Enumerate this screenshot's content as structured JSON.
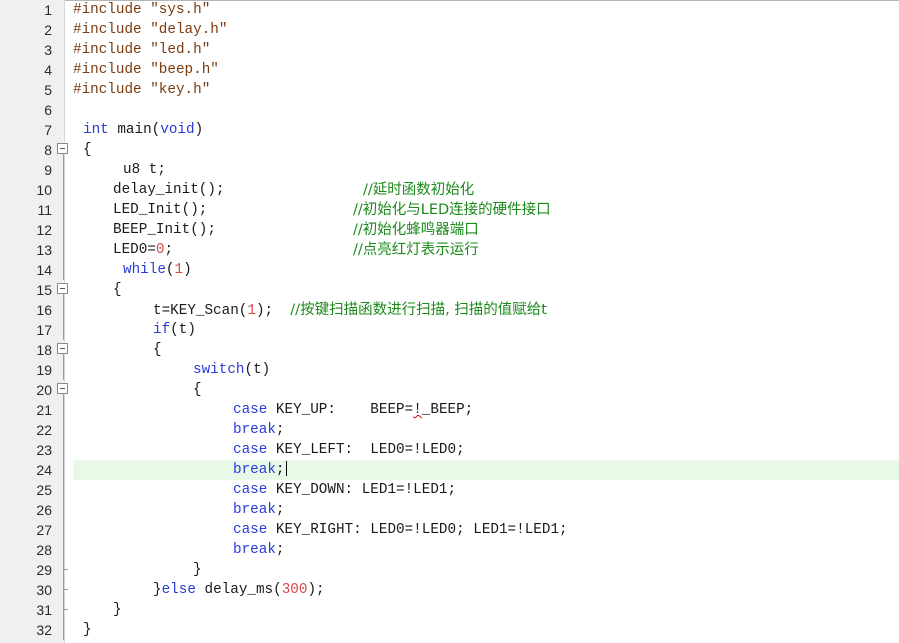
{
  "editor": {
    "current_line": 24,
    "lines": [
      {
        "num": "1",
        "fold": "",
        "indent": 0,
        "tokens": [
          {
            "c": "pp",
            "t": "#include "
          },
          {
            "c": "str",
            "t": "\"sys.h\""
          }
        ]
      },
      {
        "num": "2",
        "fold": "",
        "indent": 0,
        "tokens": [
          {
            "c": "pp",
            "t": "#include "
          },
          {
            "c": "str",
            "t": "\"delay.h\""
          }
        ]
      },
      {
        "num": "3",
        "fold": "",
        "indent": 0,
        "tokens": [
          {
            "c": "pp",
            "t": "#include "
          },
          {
            "c": "str",
            "t": "\"led.h\""
          }
        ]
      },
      {
        "num": "4",
        "fold": "",
        "indent": 0,
        "tokens": [
          {
            "c": "pp",
            "t": "#include "
          },
          {
            "c": "str",
            "t": "\"beep.h\""
          }
        ]
      },
      {
        "num": "5",
        "fold": "",
        "indent": 0,
        "tokens": [
          {
            "c": "pp",
            "t": "#include "
          },
          {
            "c": "str",
            "t": "\"key.h\""
          }
        ]
      },
      {
        "num": "6",
        "fold": "",
        "indent": 0,
        "tokens": []
      },
      {
        "num": "7",
        "fold": "",
        "indent": 10,
        "tokens": [
          {
            "c": "kw",
            "t": "int"
          },
          {
            "c": "id",
            "t": " main("
          },
          {
            "c": "kw",
            "t": "void"
          },
          {
            "c": "id",
            "t": ")"
          }
        ]
      },
      {
        "num": "8",
        "fold": "open",
        "indent": 10,
        "tokens": [
          {
            "c": "id",
            "t": "{"
          }
        ]
      },
      {
        "num": "9",
        "fold": "line",
        "indent": 50,
        "tokens": [
          {
            "c": "id",
            "t": "u8 t;"
          }
        ]
      },
      {
        "num": "10",
        "fold": "line",
        "indent": 40,
        "tokens": [
          {
            "c": "id",
            "t": "delay_init();"
          }
        ]
      },
      {
        "num": "11",
        "fold": "line",
        "indent": 40,
        "tokens": [
          {
            "c": "id",
            "t": "LED_Init();"
          }
        ]
      },
      {
        "num": "12",
        "fold": "line",
        "indent": 40,
        "tokens": [
          {
            "c": "id",
            "t": "BEEP_Init();"
          }
        ]
      },
      {
        "num": "13",
        "fold": "line",
        "indent": 40,
        "tokens": [
          {
            "c": "id",
            "t": "LED0="
          },
          {
            "c": "num",
            "t": "0"
          },
          {
            "c": "id",
            "t": ";"
          }
        ]
      },
      {
        "num": "14",
        "fold": "line",
        "indent": 50,
        "tokens": [
          {
            "c": "kw",
            "t": "while"
          },
          {
            "c": "id",
            "t": "("
          },
          {
            "c": "num",
            "t": "1"
          },
          {
            "c": "id",
            "t": ")"
          }
        ]
      },
      {
        "num": "15",
        "fold": "open",
        "indent": 40,
        "tokens": [
          {
            "c": "id",
            "t": "{"
          }
        ]
      },
      {
        "num": "16",
        "fold": "line",
        "indent": 80,
        "tokens": [
          {
            "c": "id",
            "t": "t=KEY_Scan("
          },
          {
            "c": "num",
            "t": "1"
          },
          {
            "c": "id",
            "t": ");  "
          },
          {
            "c": "cmt",
            "t": "//按键扫描函数进行扫描, 扫描的值赋给t"
          }
        ]
      },
      {
        "num": "17",
        "fold": "line",
        "indent": 80,
        "tokens": [
          {
            "c": "kw",
            "t": "if"
          },
          {
            "c": "id",
            "t": "(t)"
          }
        ]
      },
      {
        "num": "18",
        "fold": "open",
        "indent": 80,
        "tokens": [
          {
            "c": "id",
            "t": "{"
          }
        ]
      },
      {
        "num": "19",
        "fold": "line",
        "indent": 120,
        "tokens": [
          {
            "c": "kw",
            "t": "switch"
          },
          {
            "c": "id",
            "t": "(t)"
          }
        ]
      },
      {
        "num": "20",
        "fold": "open",
        "indent": 120,
        "tokens": [
          {
            "c": "id",
            "t": "{"
          }
        ]
      },
      {
        "num": "21",
        "fold": "line",
        "indent": 160,
        "tokens": [
          {
            "c": "kw",
            "t": "case"
          },
          {
            "c": "id",
            "t": " KEY_UP:    BEEP="
          },
          {
            "c": "err",
            "t": "!"
          },
          {
            "c": "id",
            "t": "_BEEP;"
          }
        ]
      },
      {
        "num": "22",
        "fold": "line",
        "indent": 160,
        "tokens": [
          {
            "c": "kw",
            "t": "break"
          },
          {
            "c": "id",
            "t": ";"
          }
        ]
      },
      {
        "num": "23",
        "fold": "line",
        "indent": 160,
        "tokens": [
          {
            "c": "kw",
            "t": "case"
          },
          {
            "c": "id",
            "t": " KEY_LEFT:  LED0=!LED0;"
          }
        ]
      },
      {
        "num": "24",
        "fold": "line",
        "indent": 160,
        "tokens": [
          {
            "c": "kw",
            "t": "break"
          },
          {
            "c": "id",
            "t": ";"
          }
        ]
      },
      {
        "num": "25",
        "fold": "line",
        "indent": 160,
        "tokens": [
          {
            "c": "kw",
            "t": "case"
          },
          {
            "c": "id",
            "t": " KEY_DOWN: LED1=!LED1;"
          }
        ]
      },
      {
        "num": "26",
        "fold": "line",
        "indent": 160,
        "tokens": [
          {
            "c": "kw",
            "t": "break"
          },
          {
            "c": "id",
            "t": ";"
          }
        ]
      },
      {
        "num": "27",
        "fold": "line",
        "indent": 160,
        "tokens": [
          {
            "c": "kw",
            "t": "case"
          },
          {
            "c": "id",
            "t": " KEY_RIGHT: LED0=!LED0; LED1=!LED1;"
          }
        ]
      },
      {
        "num": "28",
        "fold": "line",
        "indent": 160,
        "tokens": [
          {
            "c": "kw",
            "t": "break"
          },
          {
            "c": "id",
            "t": ";"
          }
        ]
      },
      {
        "num": "29",
        "fold": "end",
        "indent": 120,
        "tokens": [
          {
            "c": "id",
            "t": "}"
          }
        ]
      },
      {
        "num": "30",
        "fold": "end",
        "indent": 80,
        "tokens": [
          {
            "c": "id",
            "t": "}"
          },
          {
            "c": "kw",
            "t": "else"
          },
          {
            "c": "id",
            "t": " delay_ms("
          },
          {
            "c": "num",
            "t": "300"
          },
          {
            "c": "id",
            "t": ");"
          }
        ]
      },
      {
        "num": "31",
        "fold": "end",
        "indent": 40,
        "tokens": [
          {
            "c": "id",
            "t": "}"
          }
        ]
      },
      {
        "num": "32",
        "fold": "line",
        "indent": 10,
        "tokens": [
          {
            "c": "id",
            "t": "}"
          }
        ]
      }
    ],
    "side_comments": [
      {
        "line": "10",
        "text": "//延时函数初始化",
        "col": 290
      },
      {
        "line": "11",
        "text": "//初始化与LED连接的硬件接口",
        "col": 280
      },
      {
        "line": "12",
        "text": "//初始化蜂鸣器端口",
        "col": 280
      },
      {
        "line": "13",
        "text": "//点亮红灯表示运行",
        "col": 280
      }
    ]
  }
}
